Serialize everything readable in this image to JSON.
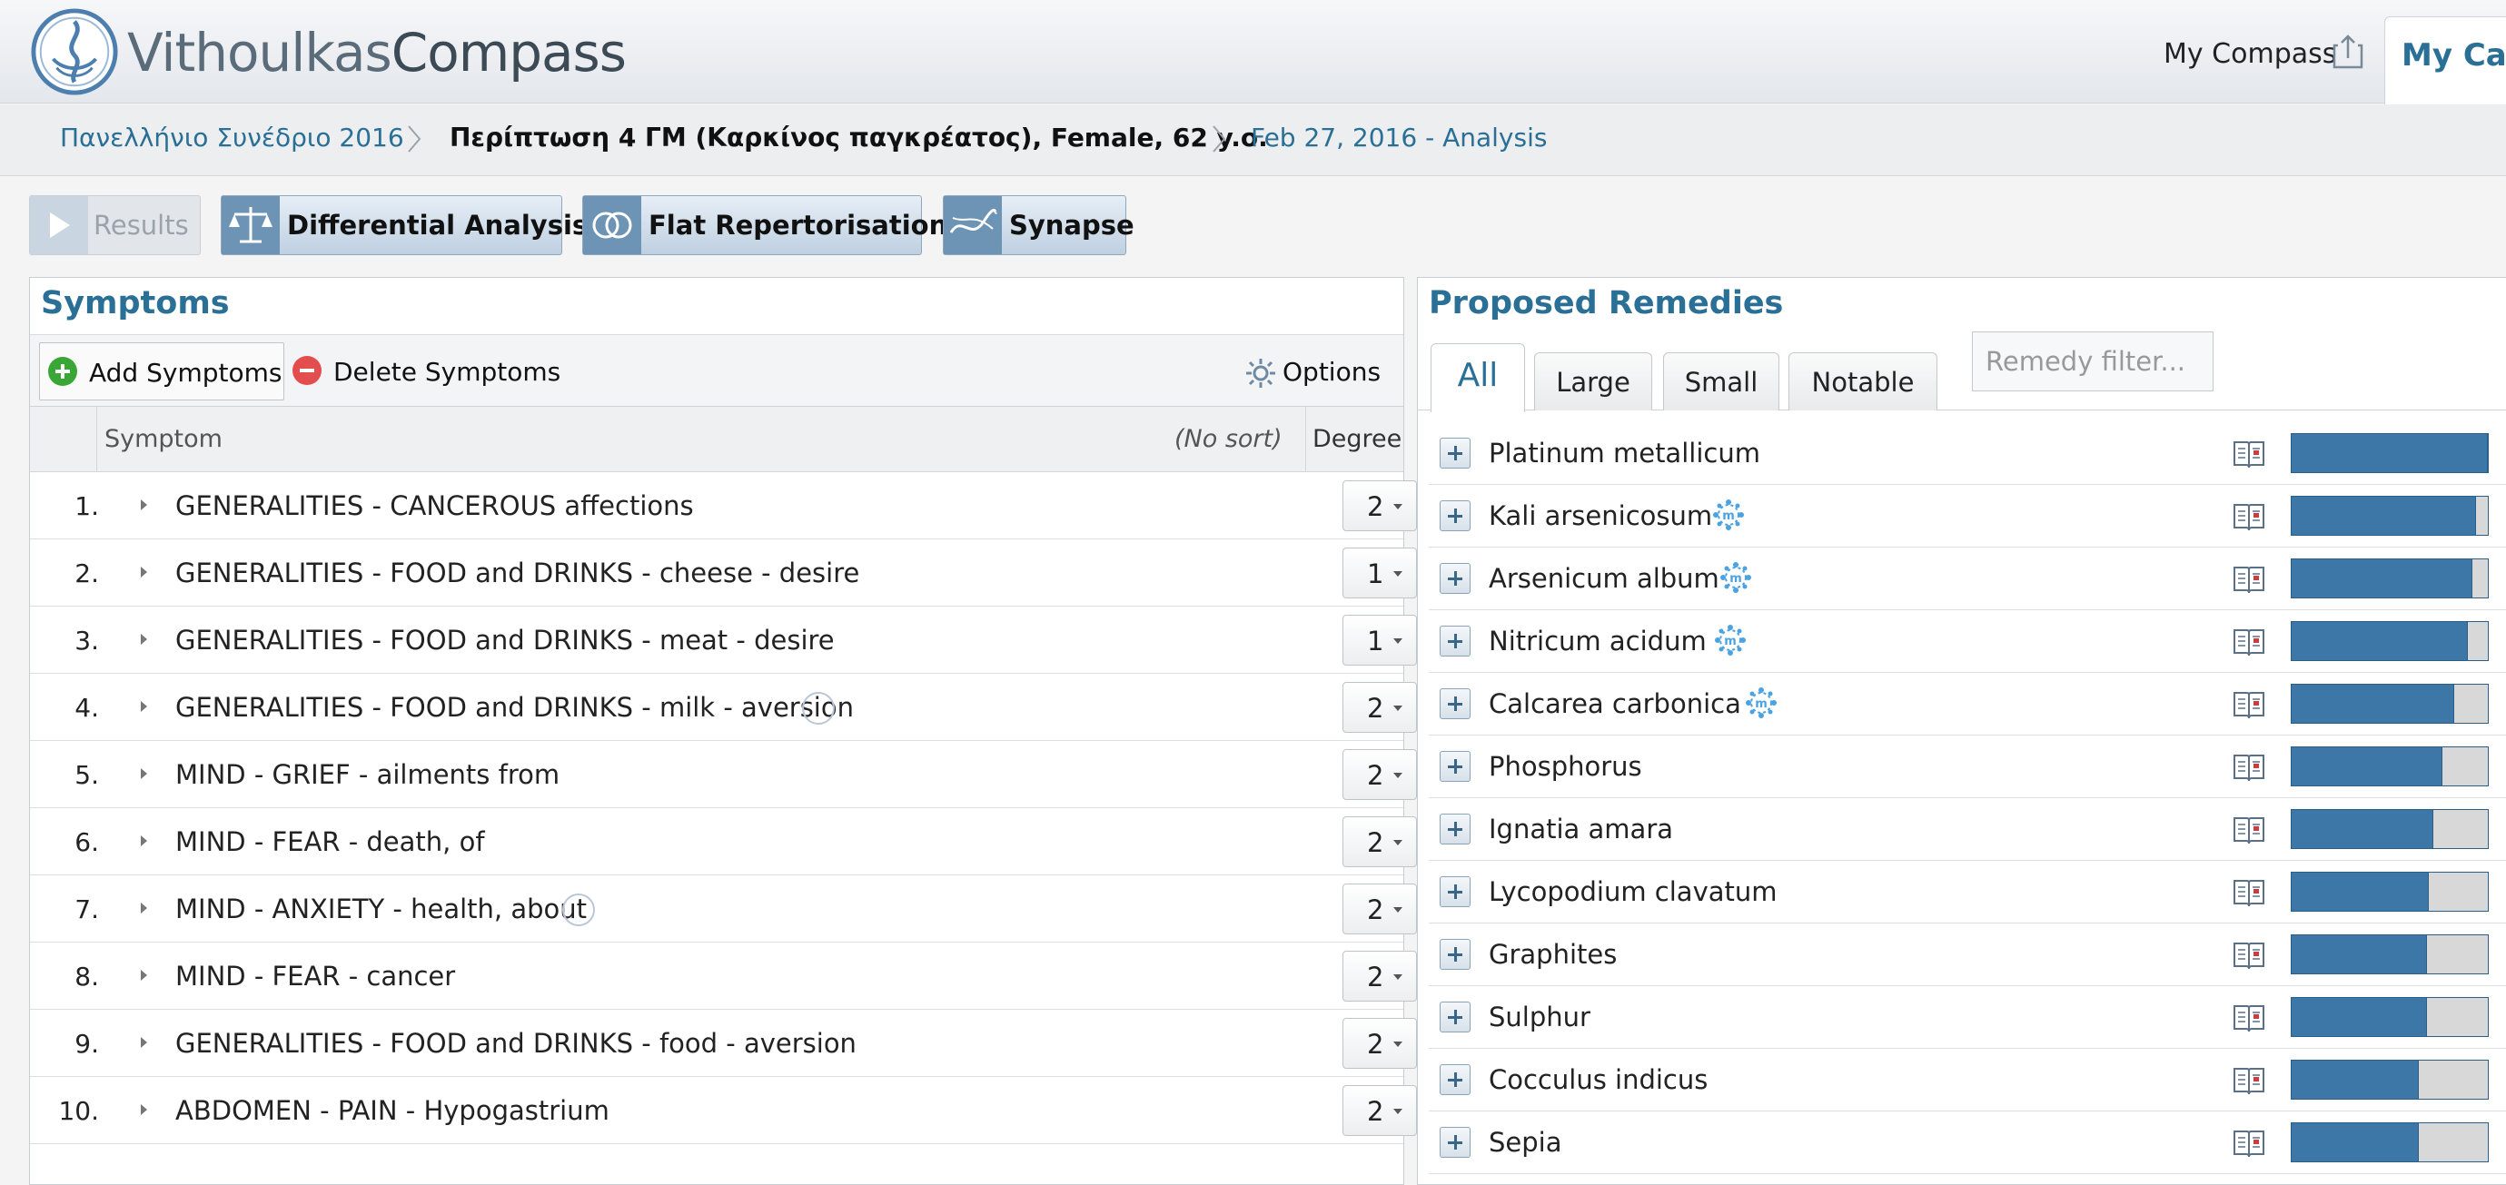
{
  "app": {
    "brand_part1": "Vithoulkas",
    "brand_part2": "Compass",
    "my_compass": "My Compass",
    "my_case_tab": "My Case"
  },
  "breadcrumb": [
    "Πανελλήνιο Συνέδριο 2016",
    "Περίπτωση 4 ΓΜ (Καρκίνος παγκρέατος), Female, 62 y.o.",
    "Feb 27, 2016 - Analysis"
  ],
  "toolbar": {
    "results": "Results",
    "differential": "Differential Analysis",
    "flat": "Flat Repertorisation",
    "synapse": "Synapse"
  },
  "symptoms": {
    "title": "Symptoms",
    "add": "Add Symptoms",
    "delete": "Delete Symptoms",
    "options": "Options",
    "col_symptom": "Symptom",
    "col_sort": "(No sort)",
    "col_degree": "Degree",
    "rows": [
      {
        "num": "1.",
        "text": "GENERALITIES - CANCEROUS affections",
        "degree": "2"
      },
      {
        "num": "2.",
        "text": "GENERALITIES - FOOD and DRINKS - cheese - desire",
        "degree": "1"
      },
      {
        "num": "3.",
        "text": "GENERALITIES - FOOD and DRINKS - meat - desire",
        "degree": "1"
      },
      {
        "num": "4.",
        "text": "GENERALITIES - FOOD and DRINKS - milk - aversion",
        "degree": "2"
      },
      {
        "num": "5.",
        "text": "MIND - GRIEF - ailments from",
        "degree": "2"
      },
      {
        "num": "6.",
        "text": "MIND - FEAR - death, of",
        "degree": "2"
      },
      {
        "num": "7.",
        "text": "MIND - ANXIETY - health, about",
        "degree": "2"
      },
      {
        "num": "8.",
        "text": "MIND - FEAR - cancer",
        "degree": "2"
      },
      {
        "num": "9.",
        "text": "GENERALITIES - FOOD and DRINKS - food - aversion",
        "degree": "2"
      },
      {
        "num": "10.",
        "text": "ABDOMEN - PAIN - Hypogastrium",
        "degree": "2"
      }
    ]
  },
  "remedies": {
    "title": "Proposed Remedies",
    "tabs": [
      "All",
      "Large",
      "Small",
      "Notable"
    ],
    "filter_placeholder": "Remedy filter...",
    "rows": [
      {
        "name": "Platinum metallicum",
        "score": 1.0
      },
      {
        "name": "Kali arsenicosum",
        "score": 0.94
      },
      {
        "name": "Arsenicum album",
        "score": 0.92
      },
      {
        "name": "Nitricum acidum",
        "score": 0.9
      },
      {
        "name": "Calcarea carbonica",
        "score": 0.83
      },
      {
        "name": "Phosphorus",
        "score": 0.77
      },
      {
        "name": "Ignatia amara",
        "score": 0.72
      },
      {
        "name": "Lycopodium clavatum",
        "score": 0.7
      },
      {
        "name": "Graphites",
        "score": 0.69
      },
      {
        "name": "Sulphur",
        "score": 0.69
      },
      {
        "name": "Cocculus indicus",
        "score": 0.65
      },
      {
        "name": "Sepia",
        "score": 0.65
      }
    ]
  }
}
